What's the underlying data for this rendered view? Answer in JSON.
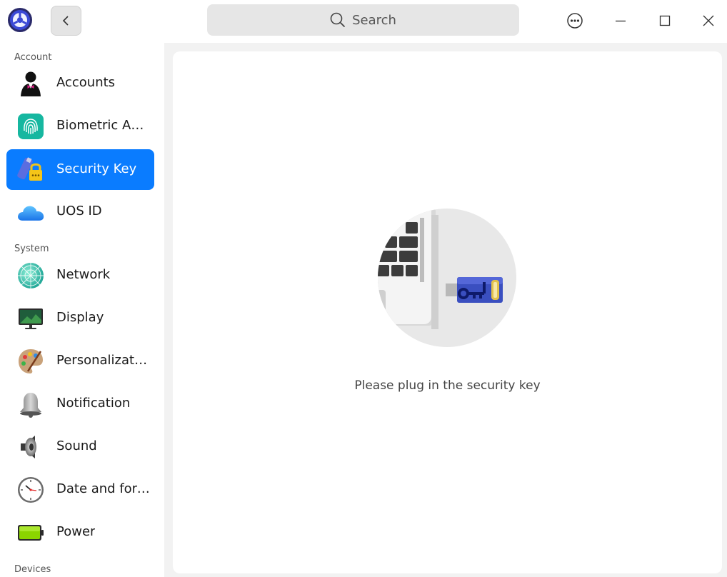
{
  "window": {
    "search_placeholder": "Search",
    "icons": {
      "app": "control-center-logo-icon",
      "back": "chevron-left-icon",
      "search": "search-icon",
      "menu": "more-options-icon",
      "minimize": "minimize-icon",
      "maximize": "maximize-icon",
      "close": "close-icon"
    }
  },
  "sidebar": {
    "sections": {
      "account": "Account",
      "system": "System",
      "devices": "Devices"
    },
    "items": [
      {
        "label": "Accounts",
        "icon": "accounts-icon"
      },
      {
        "label": "Biometric Authentication",
        "icon": "fingerprint-icon"
      },
      {
        "label": "Security Key",
        "icon": "security-key-icon",
        "active": true
      },
      {
        "label": "UOS ID",
        "icon": "cloud-icon"
      },
      {
        "label": "Network",
        "icon": "network-icon"
      },
      {
        "label": "Display",
        "icon": "display-icon"
      },
      {
        "label": "Personalization",
        "icon": "palette-icon"
      },
      {
        "label": "Notification",
        "icon": "bell-icon"
      },
      {
        "label": "Sound",
        "icon": "speaker-icon"
      },
      {
        "label": "Date and format",
        "icon": "clock-icon"
      },
      {
        "label": "Power",
        "icon": "battery-icon"
      }
    ],
    "accent_color": "#0a7cff"
  },
  "main": {
    "message": "Please plug in the security key",
    "illustration": "security-key-plug-illustration"
  }
}
